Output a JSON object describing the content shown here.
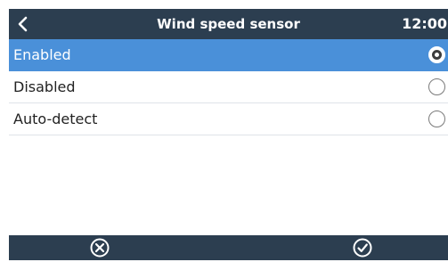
{
  "header": {
    "title": "Wind speed sensor",
    "clock": "12:00",
    "back_icon": "chevron-left-icon"
  },
  "options": [
    {
      "label": "Enabled",
      "selected": true
    },
    {
      "label": "Disabled",
      "selected": false
    },
    {
      "label": "Auto-detect",
      "selected": false
    }
  ],
  "footer": {
    "cancel_icon": "circle-x-icon",
    "accept_icon": "circle-check-icon"
  },
  "colors": {
    "bar": "#2c3e50",
    "selection": "#4a90d9",
    "text": "#222222",
    "divider": "#dfe3e8"
  }
}
